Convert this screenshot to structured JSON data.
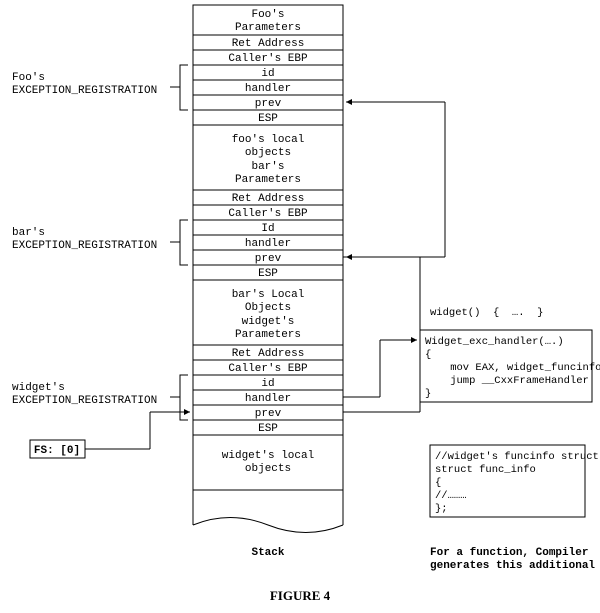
{
  "figure_title": "FIGURE 4",
  "stack_label": "Stack",
  "footer_note_l1": "For a function, Compiler",
  "footer_note_l2": "generates this additional data",
  "fs_box": "FS: [0]",
  "labels": {
    "foo_l1": "Foo's",
    "foo_l2": "EXCEPTION_REGISTRATION",
    "bar_l1": "bar's",
    "bar_l2": "EXCEPTION_REGISTRATION",
    "widget_l1": "widget's",
    "widget_l2": "EXCEPTION_REGISTRATION"
  },
  "cells": {
    "foo_params_l1": "Foo's",
    "foo_params_l2": "Parameters",
    "foo_ret": "Ret Address",
    "foo_ebp": "Caller's EBP",
    "foo_id": "id",
    "foo_handler": "handler",
    "foo_prev": "prev",
    "foo_esp": "ESP",
    "foo_locals_l1": "foo's local",
    "foo_locals_l2": "objects",
    "bar_params_l1": "bar's",
    "bar_params_l2": "Parameters",
    "bar_ret": "Ret Address",
    "bar_ebp": "Caller's EBP",
    "bar_id": "Id",
    "bar_handler": "handler",
    "bar_prev": "prev",
    "bar_esp": "ESP",
    "bar_locals_l1": "bar's Local",
    "bar_locals_l2": "Objects",
    "widget_params_l1": "widget's",
    "widget_params_l2": "Parameters",
    "widget_ret": "Ret Address",
    "widget_ebp": "Caller's EBP",
    "widget_id": "id",
    "widget_handler": "handler",
    "widget_prev": "prev",
    "widget_esp": "ESP",
    "widget_locals_l1": "widget's local",
    "widget_locals_l2": "objects"
  },
  "code_widget_sig": "widget()  {  ….  }",
  "code_handler_l1": "Widget_exc_handler(….)",
  "code_handler_l2": "{",
  "code_handler_l3": "    mov EAX, widget_funcinfo_ptr",
  "code_handler_l4": "    jump __CxxFrameHandler",
  "code_handler_l5": "}",
  "code_struct_l1": "//widget's funcinfo struct",
  "code_struct_l2": "struct func_info",
  "code_struct_l3": "{",
  "code_struct_l4": "//………",
  "code_struct_l5": "};"
}
